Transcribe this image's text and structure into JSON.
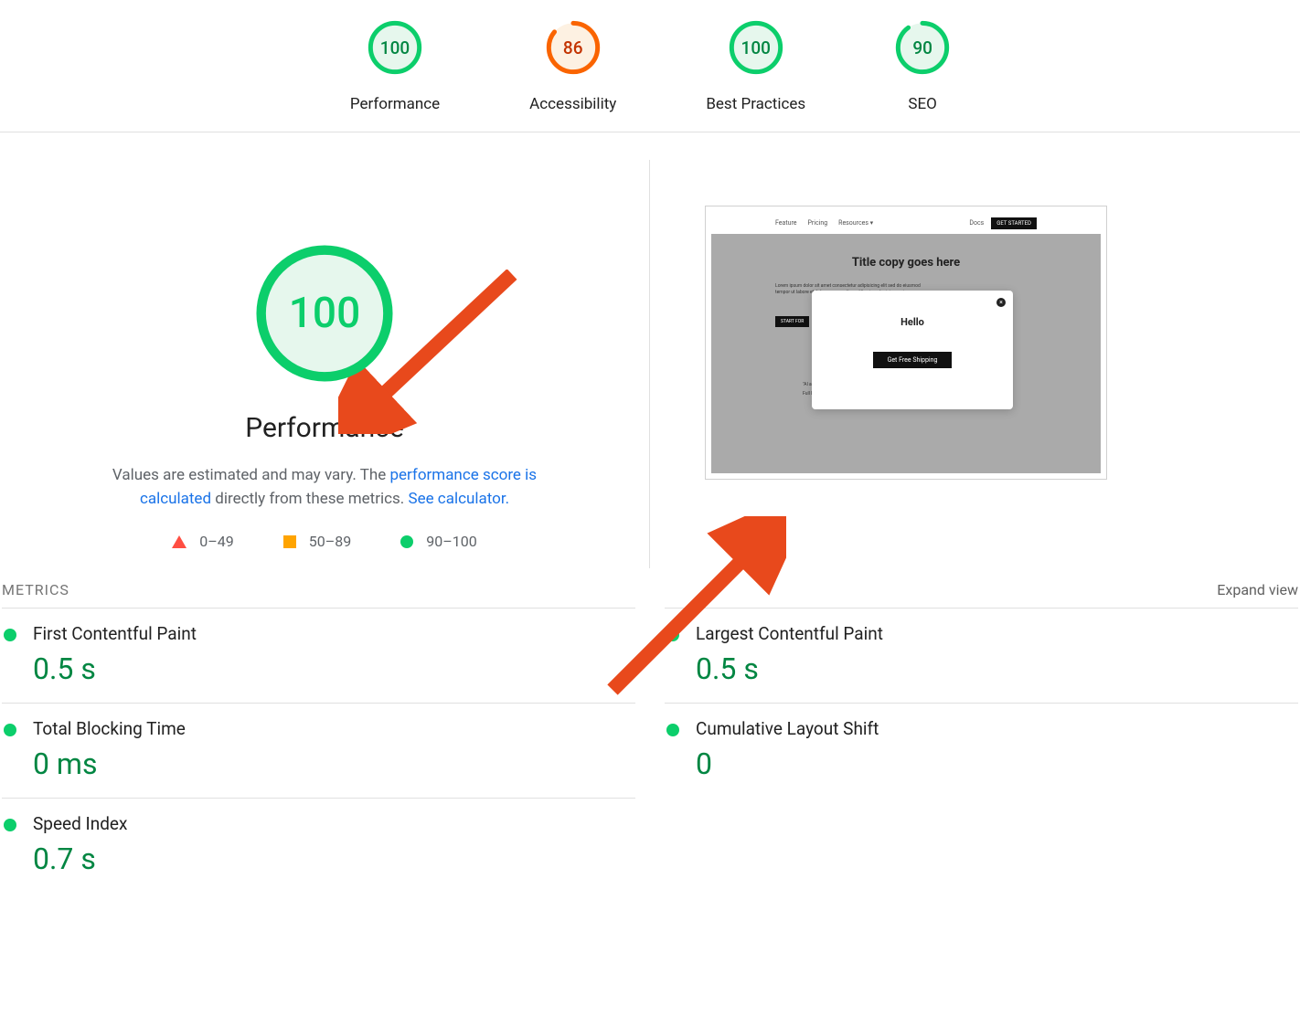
{
  "gauges": [
    {
      "label": "Performance",
      "score": "100",
      "pct": 100,
      "color": "#0cce6b",
      "fill": "#e6f7ed"
    },
    {
      "label": "Accessibility",
      "score": "86",
      "pct": 86,
      "color": "#fa6400",
      "fill": "#fdf1e2",
      "textColor": "#c33300"
    },
    {
      "label": "Best Practices",
      "score": "100",
      "pct": 100,
      "color": "#0cce6b",
      "fill": "#e6f7ed"
    },
    {
      "label": "SEO",
      "score": "90",
      "pct": 90,
      "color": "#0cce6b",
      "fill": "#e6f7ed"
    }
  ],
  "performance": {
    "title": "Performance",
    "score": "100",
    "desc_prefix": "Values are estimated and may vary. The ",
    "link1": "performance score is calculated",
    "desc_mid": " directly from these metrics. ",
    "link2": "See calculator.",
    "legend": {
      "low": "0–49",
      "mid": "50–89",
      "high": "90–100"
    }
  },
  "screenshot": {
    "nav": {
      "item1": "Feature",
      "item2": "Pricing",
      "item3": "Resources ▾",
      "docs": "Docs",
      "cta": "GET STARTED"
    },
    "hero_title": "Title copy goes here",
    "lorem": "Lorem ipsum dolor sit amet consectetur adipisicing elit sed do eiusmod tempor ut labore et dolore magna aliqua. Ut enim ad minim veniam",
    "hero_cta": "START FOR",
    "quote": "\"Al ac id",
    "attrib": "Full Name, Title Company",
    "modal": {
      "title": "Hello",
      "button": "Get Free Shipping"
    }
  },
  "metrics_section": {
    "heading": "METRICS",
    "expand": "Expand view"
  },
  "metrics": [
    {
      "name": "First Contentful Paint",
      "value": "0.5 s"
    },
    {
      "name": "Largest Contentful Paint",
      "value": "0.5 s"
    },
    {
      "name": "Total Blocking Time",
      "value": "0 ms"
    },
    {
      "name": "Cumulative Layout Shift",
      "value": "0"
    },
    {
      "name": "Speed Index",
      "value": "0.7 s"
    }
  ]
}
